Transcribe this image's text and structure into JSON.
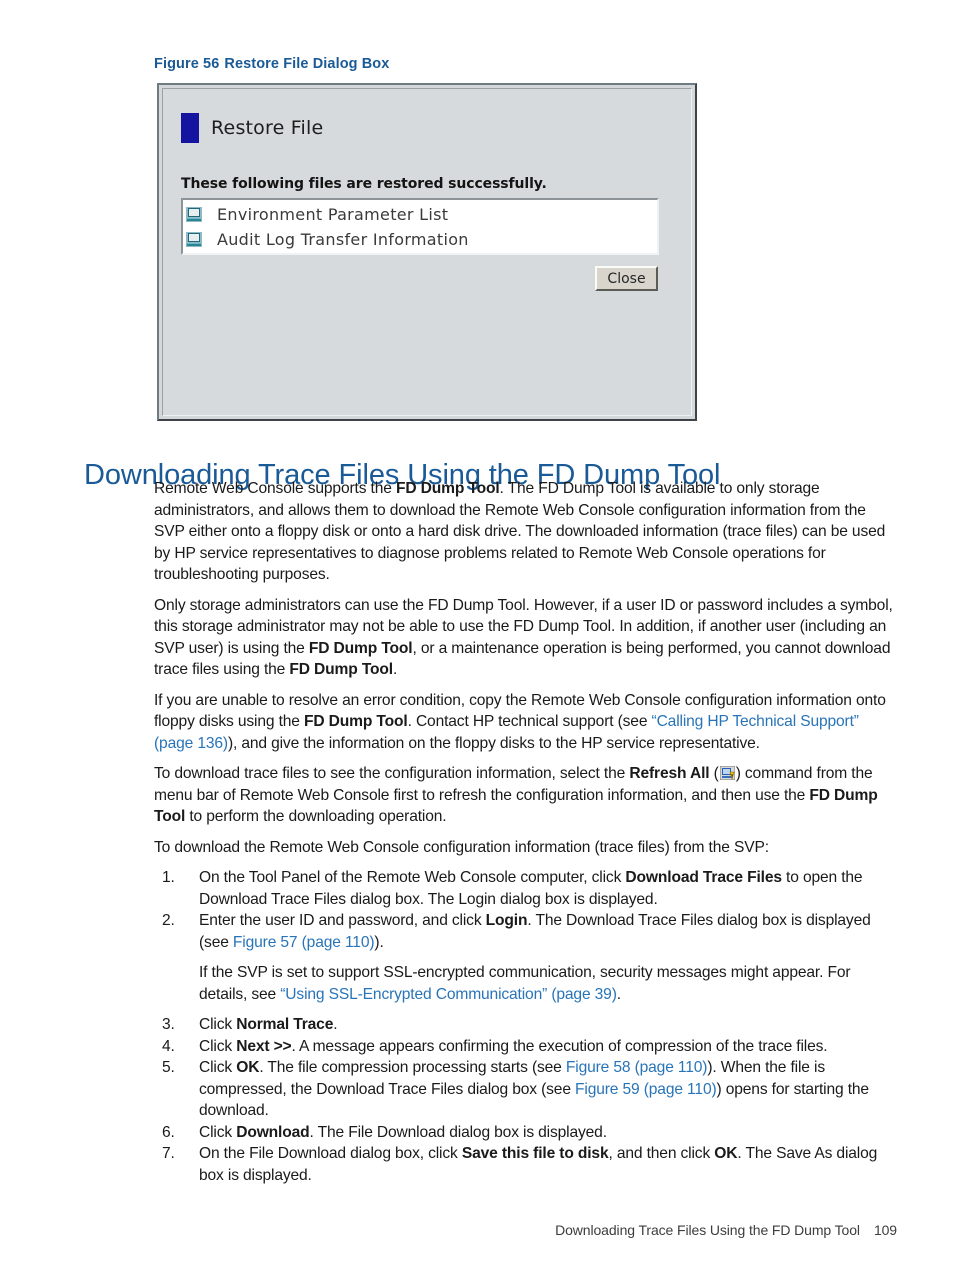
{
  "figure": {
    "caption_number": "Figure 56",
    "caption_text": "Restore File Dialog Box",
    "dialog": {
      "title": "Restore File",
      "message": "These following files are restored successfully.",
      "files": [
        "Environment Parameter List",
        "Audit Log Transfer Information"
      ],
      "close_label": "Close",
      "title_swatch_color": "#1414a0",
      "background_color": "#d6dadc"
    }
  },
  "heading": "Downloading Trace Files Using the FD Dump Tool",
  "paragraphs": {
    "p1_a": "Remote Web Console supports the ",
    "p1_b": "FD Dump Tool",
    "p1_c": ". The FD Dump Tool is available to only storage administrators, and allows them to download the Remote Web Console configuration information from the SVP either onto a floppy disk or onto a hard disk drive. The downloaded information (trace files) can be used by HP service representatives to diagnose problems related to Remote Web Console operations for troubleshooting purposes.",
    "p2_a": "Only storage administrators can use the FD Dump Tool. However, if a user ID or password includes a symbol, this storage administrator may not be able to use the FD Dump Tool. In addition, if another user (including an SVP user) is using the ",
    "p2_b": "FD Dump Tool",
    "p2_c": ", or a maintenance operation is being performed, you cannot download trace files using the ",
    "p2_d": "FD Dump Tool",
    "p2_e": ".",
    "p3_a": "If you are unable to resolve an error condition, copy the Remote Web Console configuration information onto floppy disks using the ",
    "p3_b": "FD Dump Tool",
    "p3_c": ". Contact HP technical support (see ",
    "p3_link": "“Calling HP Technical Support” (page 136)",
    "p3_d": "), and give the information on the floppy disks to the HP service representative.",
    "p4_a": "To download trace files to see the configuration information, select the ",
    "p4_b": "Refresh All",
    "p4_c": " (",
    "p4_d": ") command from the menu bar of Remote Web Console first to refresh the configuration information, and then use the ",
    "p4_e": "FD Dump Tool",
    "p4_f": " to perform the downloading operation.",
    "p5": "To download the Remote Web Console configuration information (trace files) from the SVP:"
  },
  "steps": {
    "s1_a": "On the Tool Panel of the Remote Web Console computer, click ",
    "s1_b": "Download Trace Files",
    "s1_c": " to open the Download Trace Files dialog box. The Login dialog box is displayed.",
    "s2_a": "Enter the user ID and password, and click ",
    "s2_b": "Login",
    "s2_c": ". The Download Trace Files dialog box is displayed (see ",
    "s2_link": "Figure 57 (page 110)",
    "s2_d": ").",
    "s2_note_a": "If the SVP is set to support SSL-encrypted communication, security messages might appear. For details, see ",
    "s2_note_link": "“Using SSL-Encrypted Communication” (page 39)",
    "s2_note_b": ".",
    "s3_a": "Click ",
    "s3_b": "Normal Trace",
    "s3_c": ".",
    "s4_a": "Click ",
    "s4_b": "Next >>",
    "s4_c": ". A message appears confirming the execution of compression of the trace files.",
    "s5_a": "Click ",
    "s5_b": "OK",
    "s5_c": ". The file compression processing starts (see ",
    "s5_link1": "Figure 58 (page 110)",
    "s5_d": "). When the file is compressed, the Download Trace Files dialog box (see ",
    "s5_link2": "Figure 59 (page 110)",
    "s5_e": ") opens for starting the download.",
    "s6_a": "Click ",
    "s6_b": "Download",
    "s6_c": ". The File Download dialog box is displayed.",
    "s7_a": "On the File Download dialog box, click ",
    "s7_b": "Save this file to disk",
    "s7_c": ", and then click ",
    "s7_d": "OK",
    "s7_e": ". The Save As dialog box is displayed."
  },
  "footer": {
    "section": "Downloading Trace Files Using the FD Dump Tool",
    "page_number": "109"
  },
  "colors": {
    "heading_blue": "#1a5a96",
    "link_blue": "#2874b8"
  }
}
